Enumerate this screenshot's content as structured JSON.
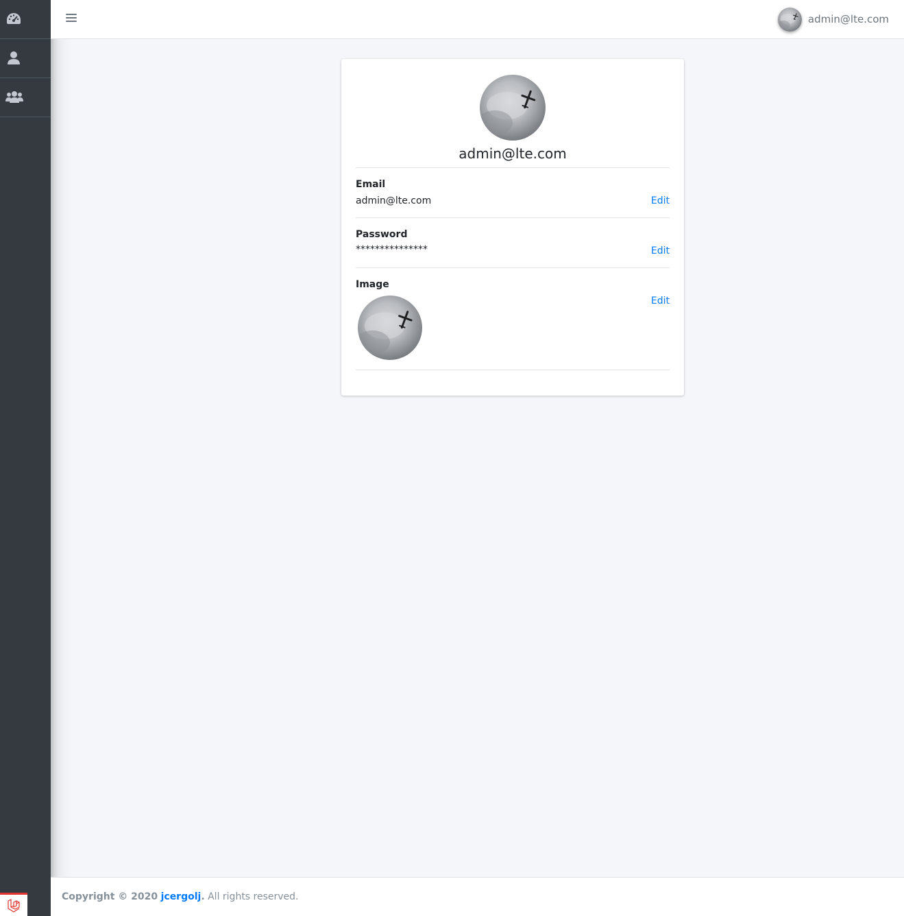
{
  "sidebar": {
    "items": [
      {
        "icon": "dashboard-icon"
      },
      {
        "icon": "user-icon"
      },
      {
        "icon": "users-icon"
      }
    ],
    "badge_icon": "laravel-logo-icon",
    "colors": {
      "background": "#343a40",
      "badge_accent": "#e3342f"
    }
  },
  "topbar": {
    "menu_icon": "hamburger-icon",
    "user_email": "admin@lte.com"
  },
  "profile": {
    "name": "admin@lte.com",
    "fields": {
      "email": {
        "label": "Email",
        "value": "admin@lte.com",
        "action": "Edit"
      },
      "password": {
        "label": "Password",
        "value": "***************",
        "action": "Edit"
      },
      "image": {
        "label": "Image",
        "action": "Edit"
      }
    }
  },
  "footer": {
    "copyright": "Copyright © 2020",
    "author": "jcergolj",
    "period": ".",
    "rights": " All rights reserved."
  },
  "colors": {
    "link": "#007bff",
    "page_bg": "#f4f6f9"
  }
}
